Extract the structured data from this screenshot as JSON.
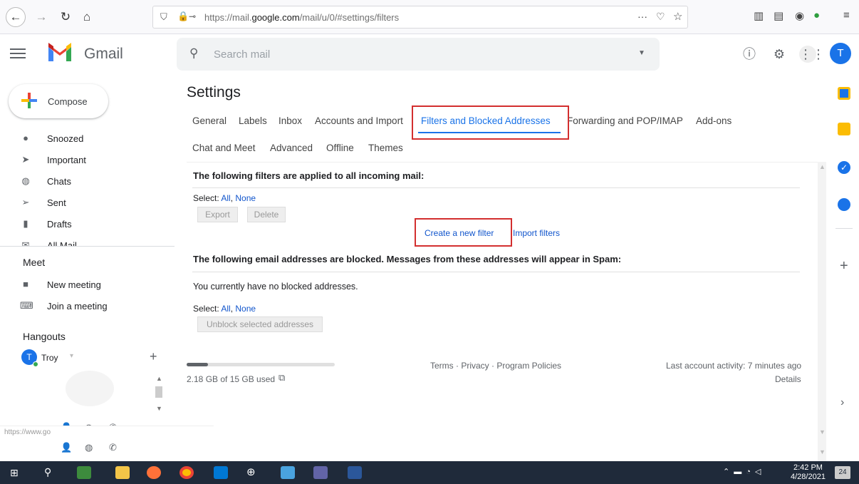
{
  "browser": {
    "url_prefix": "https://mail.",
    "url_domain": "google.com",
    "url_suffix": "/mail/u/0/#settings/filters",
    "menu_dots": "···"
  },
  "header": {
    "app_name": "Gmail",
    "search_placeholder": "Search mail",
    "avatar_letter": "T"
  },
  "sidebar": {
    "compose_label": "Compose",
    "items": [
      {
        "label": "Snoozed",
        "icon": "clock-icon"
      },
      {
        "label": "Important",
        "icon": "important-icon"
      },
      {
        "label": "Chats",
        "icon": "chat-icon"
      },
      {
        "label": "Sent",
        "icon": "send-icon"
      },
      {
        "label": "Drafts",
        "icon": "draft-icon"
      },
      {
        "label": "All Mail",
        "icon": "mail-icon"
      }
    ],
    "meet_title": "Meet",
    "meet_items": [
      {
        "label": "New meeting",
        "icon": "video-icon"
      },
      {
        "label": "Join a meeting",
        "icon": "keyboard-icon"
      }
    ],
    "hangouts_title": "Hangouts",
    "hangouts_user": "Troy",
    "hangouts_avatar": "T"
  },
  "settings": {
    "title": "Settings",
    "tabs_row1": [
      "General",
      "Labels",
      "Inbox",
      "Accounts and Import",
      "Filters and Blocked Addresses",
      "Forwarding and POP/IMAP",
      "Add-ons"
    ],
    "tabs_row2": [
      "Chat and Meet",
      "Advanced",
      "Offline",
      "Themes"
    ],
    "filters_heading": "The following filters are applied to all incoming mail:",
    "select_label": "Select:",
    "select_all": "All",
    "select_none": "None",
    "export_btn": "Export",
    "delete_btn": "Delete",
    "create_filter": "Create a new filter",
    "import_filters": "Import filters",
    "blocked_heading": "The following email addresses are blocked. Messages from these addresses will appear in Spam:",
    "no_blocked": "You currently have no blocked addresses.",
    "unblock_btn": "Unblock selected addresses"
  },
  "footer": {
    "storage_text": "2.18 GB of 15 GB used",
    "storage_fraction": 0.145,
    "links": "Terms · Privacy · Program Policies",
    "activity": "Last account activity: 7 minutes ago",
    "details": "Details"
  },
  "status_url": "https://www.go",
  "taskbar": {
    "time": "2:42 PM",
    "date": "4/28/2021",
    "notif_count": "24"
  }
}
